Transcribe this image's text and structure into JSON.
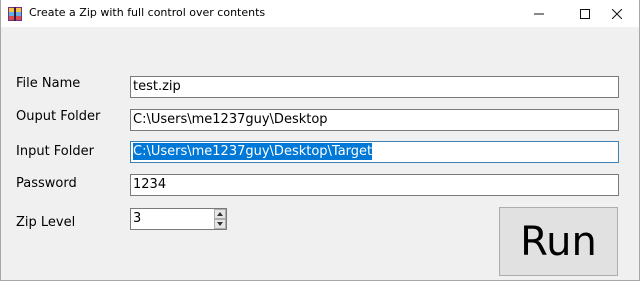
{
  "window": {
    "title": "Create a Zip with full control over contents",
    "icons": {
      "app": "winrar-app-icon",
      "minimize": "minimize-icon",
      "maximize": "maximize-icon",
      "close": "close-icon"
    }
  },
  "form": {
    "file_name": {
      "label": "File Name",
      "value": "test.zip"
    },
    "output_folder": {
      "label": "Ouput Folder",
      "value": "C:\\Users\\me1237guy\\Desktop"
    },
    "input_folder": {
      "label": "Input Folder",
      "value": "C:\\Users\\me1237guy\\Desktop\\Target",
      "selected": true
    },
    "password": {
      "label": "Password",
      "value": "1234"
    },
    "zip_level": {
      "label": "Zip Level",
      "value": "3"
    }
  },
  "run_button": {
    "label": "Run"
  },
  "colors": {
    "selection": "#0078d7",
    "focus_border": "#3c7fb1",
    "button_face": "#e1e1e1",
    "window_bg": "#f0f0f0"
  }
}
